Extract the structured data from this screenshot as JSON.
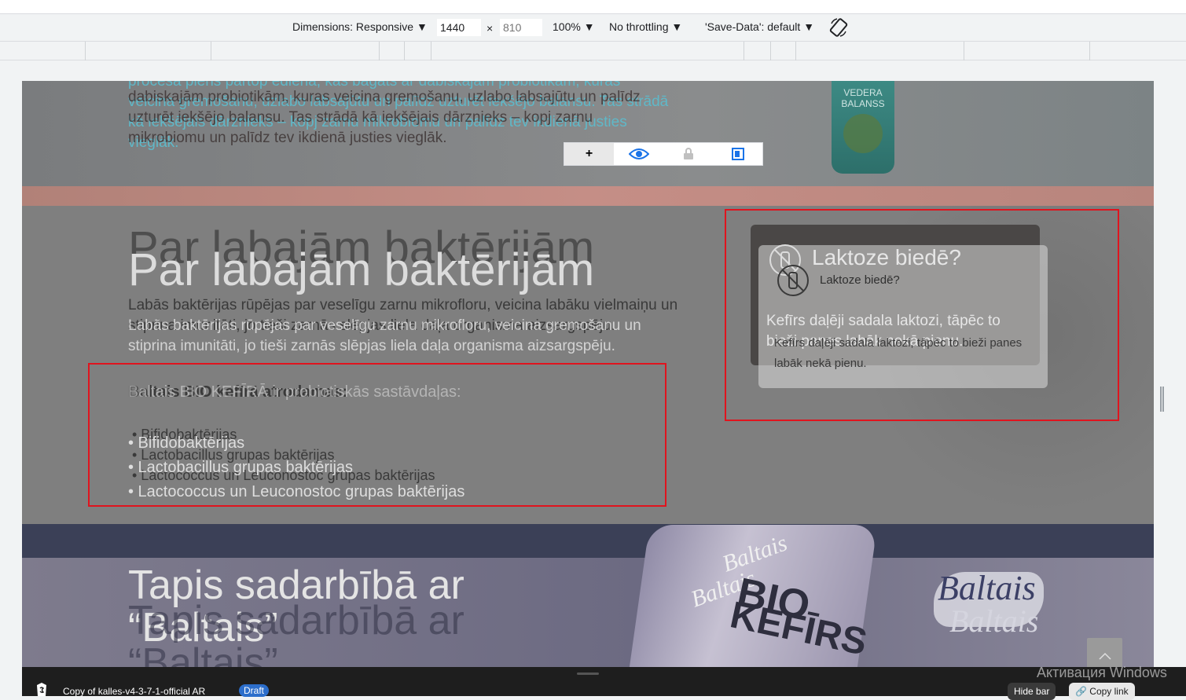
{
  "toolbar": {
    "dimensions_label": "Dimensions: Responsive ▼",
    "width_value": "1440",
    "times": "×",
    "height_placeholder": "810",
    "zoom": "100% ▼",
    "throttling": "No throttling ▼",
    "save_data": "'Save-Data': default ▼"
  },
  "hero": {
    "text_ghost": "procesā piens pārtop ēdienā, kas bagāts ar dabiskajām probiotikām, kuras veicina gremošanu, uzlabo labsajūtu un palīdz uzturēt iekšējo balansu. Tas strādā kā iekšējais dārznieks – kopj zarnu mikrobiomu un palīdz tev ikdienā justies vieglāk.",
    "text_main": "dabiskajām probiotikām, kuras veicina gremošanu, uzlabo labsajūtu un palīdz uzturēt iekšējo balansu. Tas strādā kā iekšējais dārznieks – kopj zarnu mikrobiomu un palīdz tev ikdienā justies vieglāk.",
    "bottle_label_1": "VEDERA",
    "bottle_label_2": "BALANSS"
  },
  "float_toolbar": {
    "add": "+",
    "eye": "👁",
    "lock": "🔒",
    "box": "◧"
  },
  "bacteria": {
    "title": "Par labajām baktērijām",
    "para_1": "Labās baktērijas rūpējas par veselīgu zarnu mikrofloru, veicina labāku vielmaiņu un stiprina imunitāti, jo tieši zarnās slēpjas liela daļa organisma aizsargspēju.",
    "para_2": "Labās baktērijas rūpējas par veselīgu zarnu mikrofloru, veicina gremošanu un stiprina imunitāti, jo tieši zarnās slēpjas liela daļa organisma aizsargspēju.",
    "list_title_ghost": "Baltais BIO kefīrā atrodamas:",
    "list_title_main": "Baltais BIO KEFĪRĀ ir probiotiskās sastāvdaļas:",
    "items": [
      "• Bifidobaktērijas",
      "• Lactobacillus grupas baktērijas",
      "• Lactococcus un Leuconostoc grupas baktērijas"
    ]
  },
  "card": {
    "title": "Laktoze biedē?",
    "subtitle": "Laktoze biedē?",
    "text": "Kefīrs daļēji sadala laktozi, tāpēc to bieži panes labāk nekā pienu.",
    "icon": "bottle-crossed-icon"
  },
  "partner": {
    "title": "Tapis sadarbībā ar “Baltais”",
    "logo": "Baltais",
    "bottle_1": "Baltais",
    "bottle_2": "BIO",
    "bottle_3": "KEFĪRS"
  },
  "bottom": {
    "store": "Copy of kalles-v4-3-7-1-official AR",
    "badge": "Draft",
    "hide_bar": "Hide bar",
    "copy_link": "Copy link",
    "watermark": "Активация Windows"
  }
}
